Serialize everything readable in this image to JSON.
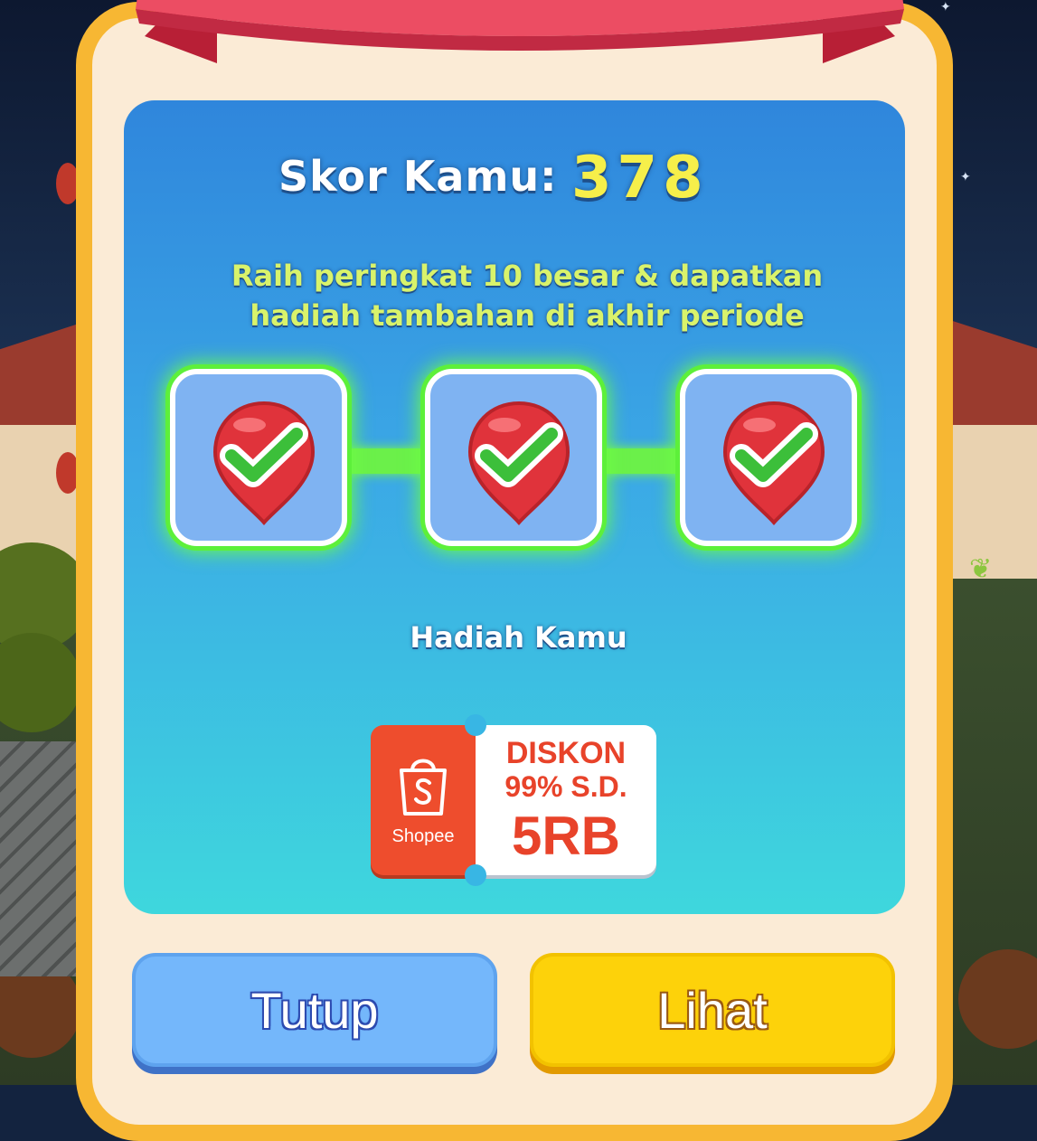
{
  "score": {
    "label": "Skor Kamu:",
    "value": "378"
  },
  "hint": {
    "line1": "Raih peringkat 10 besar & dapatkan",
    "line2": "hadiah tambahan di akhir periode"
  },
  "milestones": [
    {
      "status": "completed",
      "icon": "check-pin-icon"
    },
    {
      "status": "completed",
      "icon": "check-pin-icon"
    },
    {
      "status": "completed",
      "icon": "check-pin-icon"
    }
  ],
  "reward": {
    "title": "Hadiah Kamu",
    "voucher": {
      "brand": "Shopee",
      "line1": "DISKON",
      "line2": "99% S.D.",
      "line3": "5RB"
    }
  },
  "buttons": {
    "close": "Tutup",
    "view": "Lihat"
  },
  "colors": {
    "frame": "#f7b733",
    "panel_top": "#2f86dc",
    "panel_bottom": "#3ed7dd",
    "score_value": "#f6ef4a",
    "hint_text": "#d9f36b",
    "milestone_glow": "#5df03a",
    "shopee_orange": "#ee4d2d",
    "close_button": "#74b7fb",
    "view_button": "#fdd20a"
  }
}
